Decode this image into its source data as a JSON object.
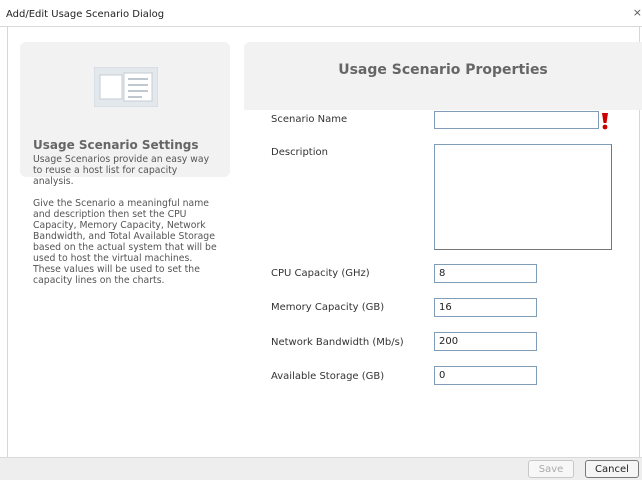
{
  "dialog": {
    "title": "Add/Edit Usage Scenario Dialog",
    "close_glyph": "×"
  },
  "settings": {
    "icon": "usage-scenario-icon",
    "title": "Usage Scenario Settings",
    "paragraph1": "Usage Scenarios provide an easy way to reuse a host list for capacity analysis.",
    "paragraph2": "Give the Scenario a meaningful name and description then set the CPU Capacity, Memory Capacity, Network Bandwidth, and Total Available Storage based on the actual system that will be used to host the virtual machines. These values will be used to set the capacity lines on the charts."
  },
  "properties": {
    "title": "Usage Scenario Properties",
    "fields": {
      "scenario_name": {
        "label": "Scenario Name",
        "value": ""
      },
      "description": {
        "label": "Description",
        "value": ""
      },
      "cpu": {
        "label": "CPU Capacity (GHz)",
        "value": "8"
      },
      "memory": {
        "label": "Memory Capacity (GB)",
        "value": "16"
      },
      "network": {
        "label": "Network Bandwidth (Mb/s)",
        "value": "200"
      },
      "storage": {
        "label": "Available Storage (GB)",
        "value": "0"
      }
    },
    "required_color": "#cc0000"
  },
  "footer": {
    "save_label": "Save",
    "cancel_label": "Cancel"
  }
}
